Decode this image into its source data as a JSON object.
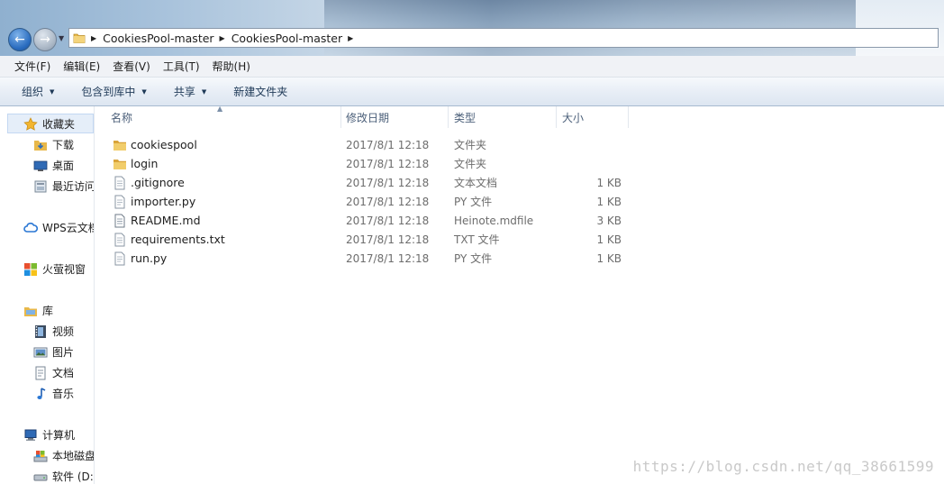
{
  "address": {
    "segments": [
      "CookiesPool-master",
      "CookiesPool-master"
    ]
  },
  "menu": [
    "文件(F)",
    "编辑(E)",
    "查看(V)",
    "工具(T)",
    "帮助(H)"
  ],
  "commands": {
    "organize": "组织",
    "include_in_library": "包含到库中",
    "share": "共享",
    "new_folder": "新建文件夹"
  },
  "nav": {
    "favorites": "收藏夹",
    "downloads": "下载",
    "desktop": "桌面",
    "recent": "最近访问",
    "wps_cloud": "WPS云文档",
    "huorong": "火萤视窗",
    "libraries": "库",
    "videos": "视频",
    "pictures": "图片",
    "documents": "文档",
    "music": "音乐",
    "computer": "计算机",
    "local_disk": "本地磁盘",
    "software_disk": "软件 (D:"
  },
  "columns": {
    "name": "名称",
    "date": "修改日期",
    "type": "类型",
    "size": "大小"
  },
  "files": [
    {
      "name": "cookiespool",
      "date": "2017/8/1 12:18",
      "type": "文件夹",
      "size": "",
      "icon": "folder-icon"
    },
    {
      "name": "login",
      "date": "2017/8/1 12:18",
      "type": "文件夹",
      "size": "",
      "icon": "folder-icon"
    },
    {
      "name": ".gitignore",
      "date": "2017/8/1 12:18",
      "type": "文本文档",
      "size": "1 KB",
      "icon": "text-file-icon"
    },
    {
      "name": "importer.py",
      "date": "2017/8/1 12:18",
      "type": "PY 文件",
      "size": "1 KB",
      "icon": "py-file-icon"
    },
    {
      "name": "README.md",
      "date": "2017/8/1 12:18",
      "type": "Heinote.mdfile",
      "size": "3 KB",
      "icon": "md-file-icon"
    },
    {
      "name": "requirements.txt",
      "date": "2017/8/1 12:18",
      "type": "TXT 文件",
      "size": "1 KB",
      "icon": "text-file-icon"
    },
    {
      "name": "run.py",
      "date": "2017/8/1 12:18",
      "type": "PY 文件",
      "size": "1 KB",
      "icon": "py-file-icon"
    }
  ],
  "watermark": "https://blog.csdn.net/qq_38661599",
  "colors": {
    "folder": "#e8b84a",
    "nav_highlight": "#e5eef9",
    "header_text": "#4c607a"
  }
}
